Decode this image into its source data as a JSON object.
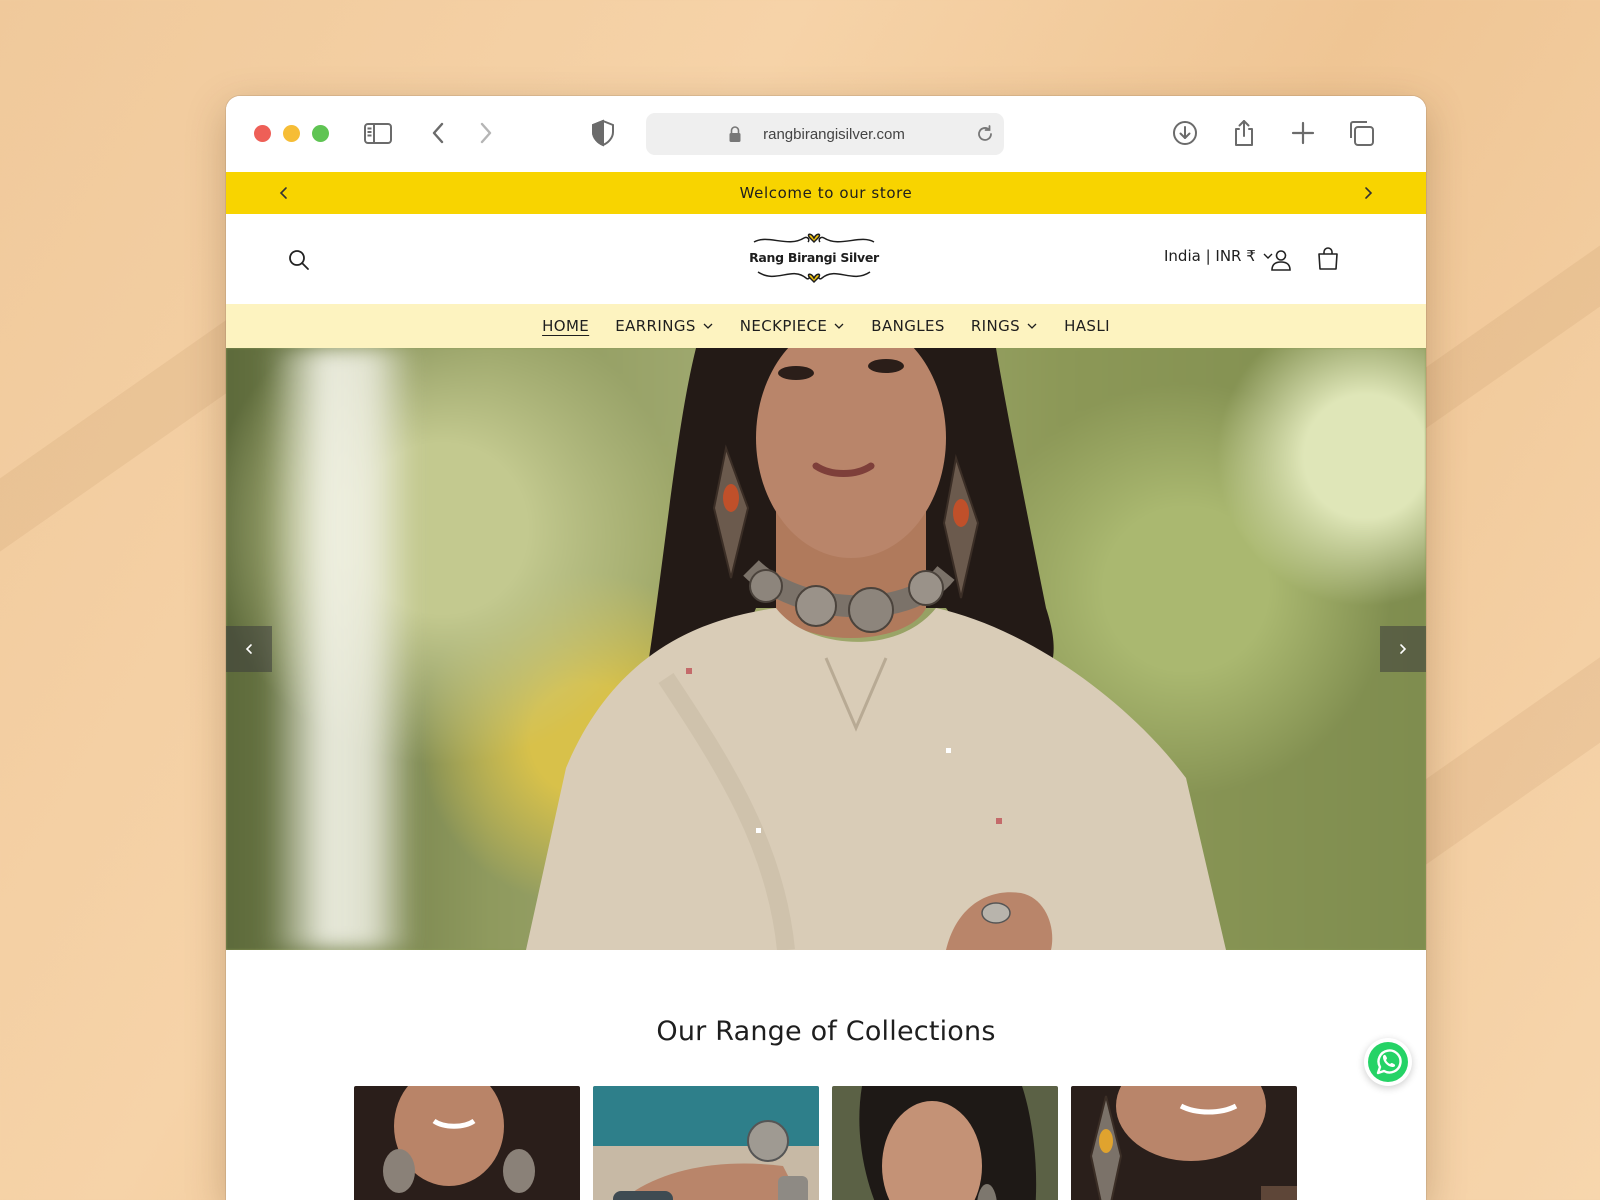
{
  "browser": {
    "url": "rangbirangisilver.com"
  },
  "announcement": {
    "text": "Welcome to our store"
  },
  "header": {
    "logo_text": "Rang Birangi Silver",
    "country_currency": "India | INR ₹"
  },
  "nav": {
    "items": [
      {
        "label": "HOME",
        "active": true,
        "dropdown": false
      },
      {
        "label": "EARRINGS",
        "active": false,
        "dropdown": true
      },
      {
        "label": "NECKPIECE",
        "active": false,
        "dropdown": true
      },
      {
        "label": "BANGLES",
        "active": false,
        "dropdown": false
      },
      {
        "label": "RINGS",
        "active": false,
        "dropdown": true
      },
      {
        "label": "HASLI",
        "active": false,
        "dropdown": false
      }
    ]
  },
  "collections": {
    "heading": "Our Range of Collections"
  },
  "colors": {
    "announcement_bg": "#f8d400",
    "nav_bg": "#fdf3c0",
    "whatsapp": "#25d366"
  },
  "icons": [
    "sidebar-icon",
    "back-icon",
    "forward-icon",
    "shield-icon",
    "lock-icon",
    "reload-icon",
    "download-icon",
    "share-icon",
    "new-tab-icon",
    "tabs-overview-icon",
    "search-icon",
    "account-icon",
    "cart-icon",
    "whatsapp-icon"
  ]
}
